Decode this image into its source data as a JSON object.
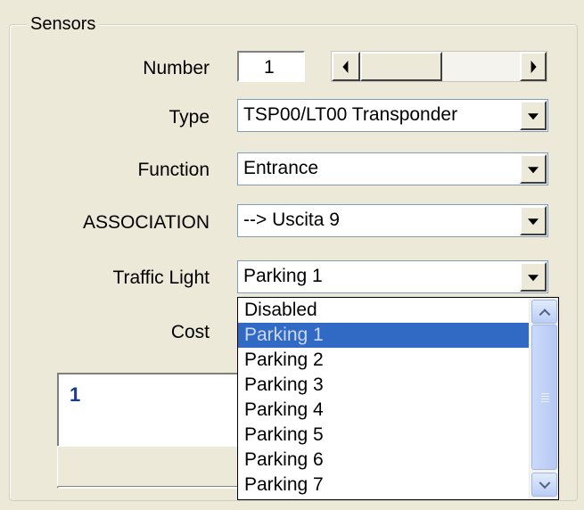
{
  "group": {
    "title": "Sensors"
  },
  "number": {
    "label": "Number",
    "value": "1"
  },
  "type": {
    "label": "Type",
    "value": "TSP00/LT00 Transponder"
  },
  "function": {
    "label": "Function",
    "value": "Entrance"
  },
  "association": {
    "label": "ASSOCIATION",
    "value": "--> Uscita  9"
  },
  "traffic_light": {
    "label": "Traffic Light",
    "value": "Parking 1"
  },
  "cost": {
    "label": "Cost"
  },
  "memo": {
    "value": "1"
  },
  "dropdown": {
    "options": [
      "Disabled",
      "Parking 1",
      "Parking 2",
      "Parking 3",
      "Parking 4",
      "Parking 5",
      "Parking 6",
      "Parking 7"
    ],
    "selected": "Parking 1"
  },
  "colors": {
    "selection": "#316ac5",
    "panel": "#ece9d8",
    "memo_text": "#1a3c8c"
  }
}
